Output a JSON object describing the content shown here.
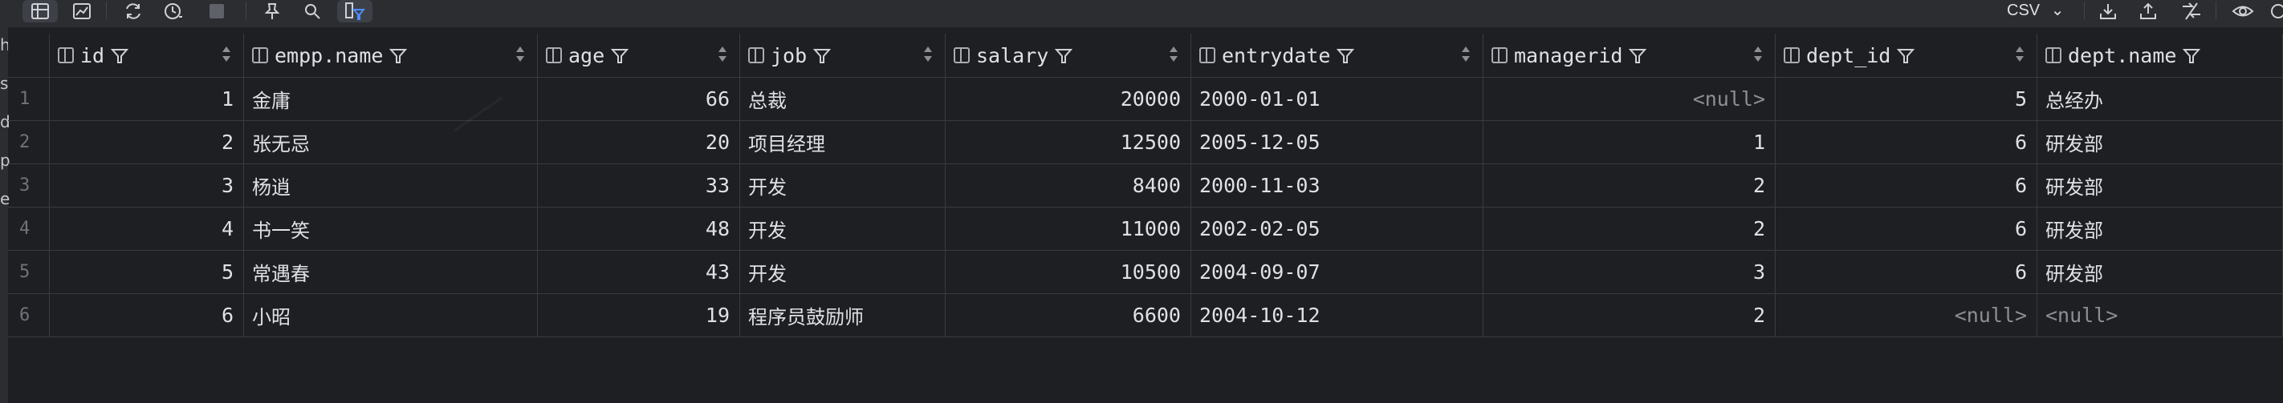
{
  "toolbar": {
    "export_format": "CSV",
    "buttons": [
      {
        "name": "table-view-icon"
      },
      {
        "name": "chart-view-icon"
      },
      {
        "name": "refresh-icon"
      },
      {
        "name": "history-icon"
      },
      {
        "name": "stop-icon"
      },
      {
        "name": "pin-icon"
      },
      {
        "name": "search-icon"
      },
      {
        "name": "filter-columns-icon"
      },
      {
        "name": "download-icon"
      },
      {
        "name": "upload-icon"
      },
      {
        "name": "compare-icon"
      },
      {
        "name": "view-icon"
      }
    ]
  },
  "left_gutter": [
    "h",
    "s",
    "d",
    "p",
    "e"
  ],
  "table": {
    "columns": [
      {
        "key": "id",
        "label": "id"
      },
      {
        "key": "empp_name",
        "label": "empp.name"
      },
      {
        "key": "age",
        "label": "age"
      },
      {
        "key": "job",
        "label": "job"
      },
      {
        "key": "salary",
        "label": "salary"
      },
      {
        "key": "entrydate",
        "label": "entrydate"
      },
      {
        "key": "managerid",
        "label": "managerid"
      },
      {
        "key": "dept_id",
        "label": "dept_id"
      },
      {
        "key": "dept_name",
        "label": "dept.name"
      }
    ],
    "rows": [
      {
        "n": "1",
        "id": "1",
        "empp_name": "金庸",
        "age": "66",
        "job": "总裁",
        "salary": "20000",
        "entrydate": "2000-01-01",
        "managerid": "<null>",
        "dept_id": "5",
        "dept_name": "总经办"
      },
      {
        "n": "2",
        "id": "2",
        "empp_name": "张无忌",
        "age": "20",
        "job": "项目经理",
        "salary": "12500",
        "entrydate": "2005-12-05",
        "managerid": "1",
        "dept_id": "6",
        "dept_name": "研发部"
      },
      {
        "n": "3",
        "id": "3",
        "empp_name": "杨逍",
        "age": "33",
        "job": "开发",
        "salary": "8400",
        "entrydate": "2000-11-03",
        "managerid": "2",
        "dept_id": "6",
        "dept_name": "研发部"
      },
      {
        "n": "4",
        "id": "4",
        "empp_name": "书一笑",
        "age": "48",
        "job": "开发",
        "salary": "11000",
        "entrydate": "2002-02-05",
        "managerid": "2",
        "dept_id": "6",
        "dept_name": "研发部"
      },
      {
        "n": "5",
        "id": "5",
        "empp_name": "常遇春",
        "age": "43",
        "job": "开发",
        "salary": "10500",
        "entrydate": "2004-09-07",
        "managerid": "3",
        "dept_id": "6",
        "dept_name": "研发部"
      },
      {
        "n": "6",
        "id": "6",
        "empp_name": "小昭",
        "age": "19",
        "job": "程序员鼓励师",
        "salary": "6600",
        "entrydate": "2004-10-12",
        "managerid": "2",
        "dept_id": "<null>",
        "dept_name": "<null>"
      }
    ]
  }
}
